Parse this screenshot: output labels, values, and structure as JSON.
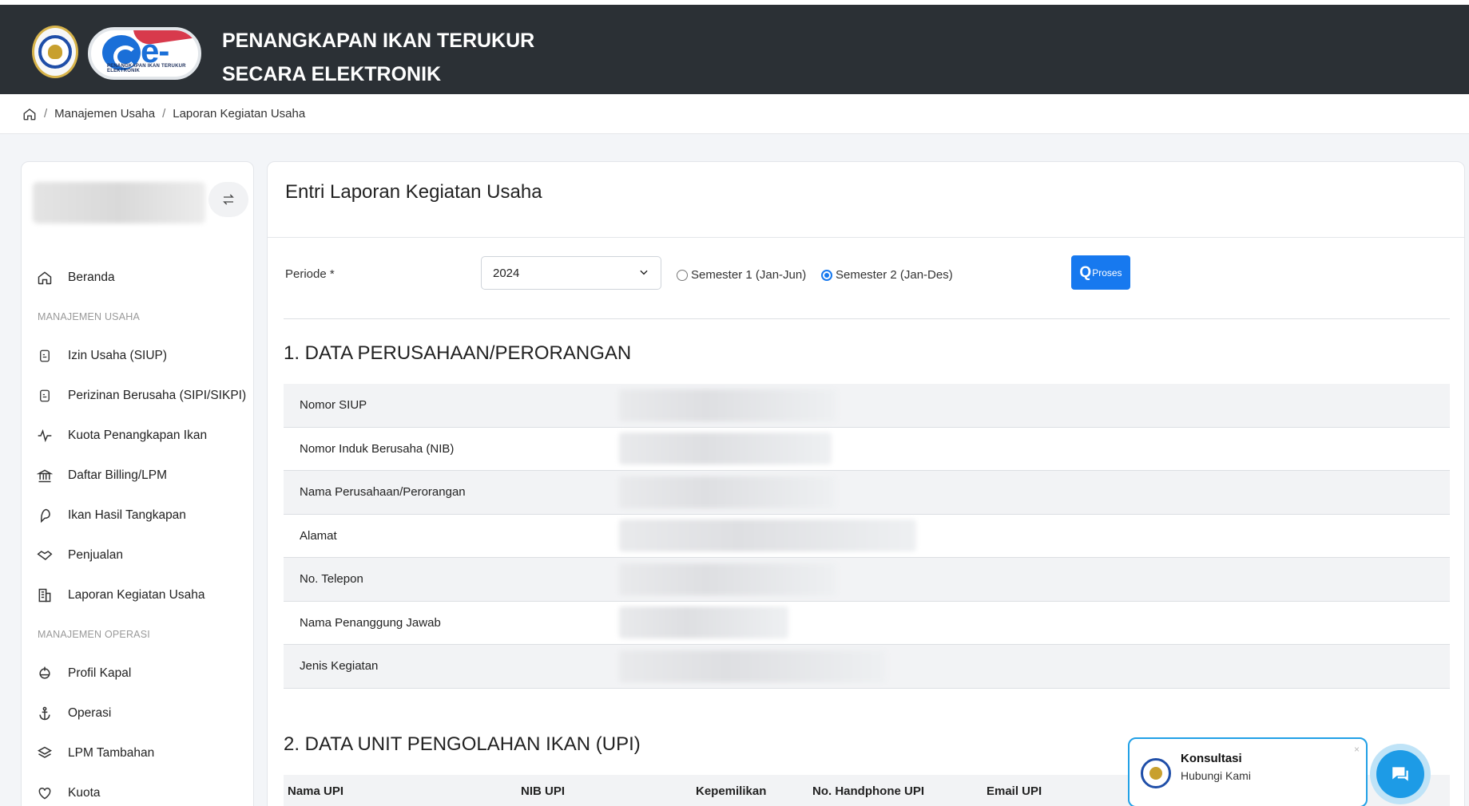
{
  "header": {
    "title_line1": "PENANGKAPAN IKAN TERUKUR",
    "title_line2": "SECARA ELEKTRONIK",
    "logo_text": "e-PIT",
    "logo_subtext": "PENANGKAPAN IKAN TERUKUR ELEKTRONIK"
  },
  "breadcrumb": {
    "items": [
      "Manajemen Usaha",
      "Laporan Kegiatan Usaha"
    ]
  },
  "sidebar": {
    "items": [
      {
        "label": "Beranda",
        "icon": "home-icon"
      },
      {
        "section": "MANAJEMEN USAHA"
      },
      {
        "label": "Izin Usaha (SIUP)",
        "icon": "document-icon"
      },
      {
        "label": "Perizinan Berusaha (SIPI/SIKPI)",
        "icon": "document-icon"
      },
      {
        "label": "Kuota Penangkapan Ikan",
        "icon": "activity-icon"
      },
      {
        "label": "Daftar Billing/LPM",
        "icon": "bank-icon"
      },
      {
        "label": "Ikan Hasil Tangkapan",
        "icon": "fish-icon"
      },
      {
        "label": "Penjualan",
        "icon": "handshake-icon"
      },
      {
        "label": "Laporan Kegiatan Usaha",
        "icon": "building-icon"
      },
      {
        "section": "MANAJEMEN OPERASI"
      },
      {
        "label": "Profil Kapal",
        "icon": "ship-icon"
      },
      {
        "label": "Operasi",
        "icon": "anchor-icon"
      },
      {
        "label": "LPM Tambahan",
        "icon": "layers-icon"
      },
      {
        "label": "Kuota",
        "icon": "heart-icon"
      }
    ]
  },
  "main": {
    "title": "Entri Laporan Kegiatan Usaha",
    "periode_label": "Periode *",
    "year_selected": "2024",
    "semester1_label": "Semester 1 (Jan-Jun)",
    "semester2_label": "Semester 2 (Jan-Des)",
    "selected_semester": 2,
    "proses_label": "Proses",
    "section1_title": "1. DATA PERUSAHAAN/PERORANGAN",
    "section1_rows": [
      "Nomor SIUP",
      "Nomor Induk Berusaha (NIB)",
      "Nama Perusahaan/Perorangan",
      "Alamat",
      "No. Telepon",
      "Nama Penanggung Jawab",
      "Jenis Kegiatan"
    ],
    "section2_title": "2. DATA UNIT PENGOLAHAN IKAN (UPI)",
    "section2_columns": [
      "Nama UPI",
      "NIB UPI",
      "Kepemilikan",
      "No. Handphone UPI",
      "Email UPI"
    ]
  },
  "chat": {
    "title": "Konsultasi",
    "subtitle": "Hubungi Kami",
    "close": "×"
  },
  "colors": {
    "header_bg": "#2b3035",
    "primary": "#1779ef",
    "chat_accent": "#1d9be6"
  }
}
